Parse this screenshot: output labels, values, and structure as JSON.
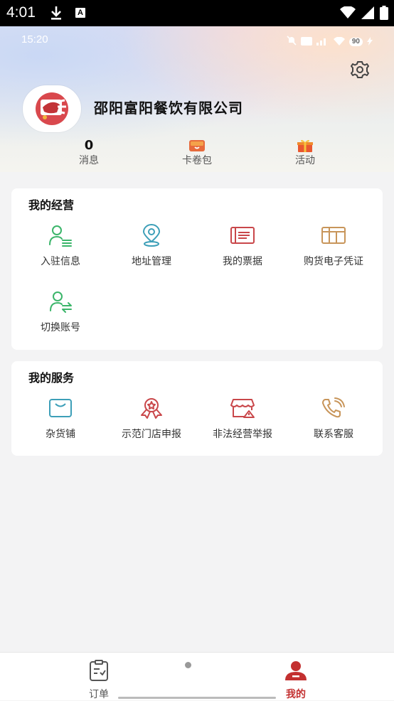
{
  "system_bar": {
    "time": "4:01",
    "badge": "A"
  },
  "inner_status": {
    "time": "15:20",
    "battery": "90"
  },
  "profile": {
    "company_name": "邵阳富阳餐饮有限公司"
  },
  "stats": [
    {
      "label": "消息",
      "value": "0",
      "icon": "message-count"
    },
    {
      "label": "卡卷包",
      "icon": "card-wallet-icon"
    },
    {
      "label": "活动",
      "icon": "gift-icon"
    }
  ],
  "business_section": {
    "title": "我的经营",
    "items": [
      {
        "label": "入驻信息",
        "icon": "user-list-icon",
        "color": "#3bb56a"
      },
      {
        "label": "地址管理",
        "icon": "location-pin-icon",
        "color": "#3d9fb8"
      },
      {
        "label": "我的票据",
        "icon": "receipt-icon",
        "color": "#c9474a"
      },
      {
        "label": "购货电子凭证",
        "icon": "voucher-box-icon",
        "color": "#c8955a"
      },
      {
        "label": "切换账号",
        "icon": "switch-account-icon",
        "color": "#3bb56a"
      }
    ]
  },
  "service_section": {
    "title": "我的服务",
    "items": [
      {
        "label": "杂货铺",
        "icon": "shopping-bag-icon",
        "color": "#3d9fb8"
      },
      {
        "label": "示范门店申报",
        "icon": "award-ribbon-icon",
        "color": "#c9474a"
      },
      {
        "label": "非法经营举报",
        "icon": "store-warning-icon",
        "color": "#c9474a"
      },
      {
        "label": "联系客服",
        "icon": "phone-icon",
        "color": "#c8955a"
      }
    ]
  },
  "tabbar": {
    "tabs": [
      {
        "label": "订单",
        "icon": "clipboard-icon",
        "active": false
      },
      {
        "label": "我的",
        "icon": "person-icon",
        "active": true
      }
    ],
    "active_color": "#c33030"
  }
}
